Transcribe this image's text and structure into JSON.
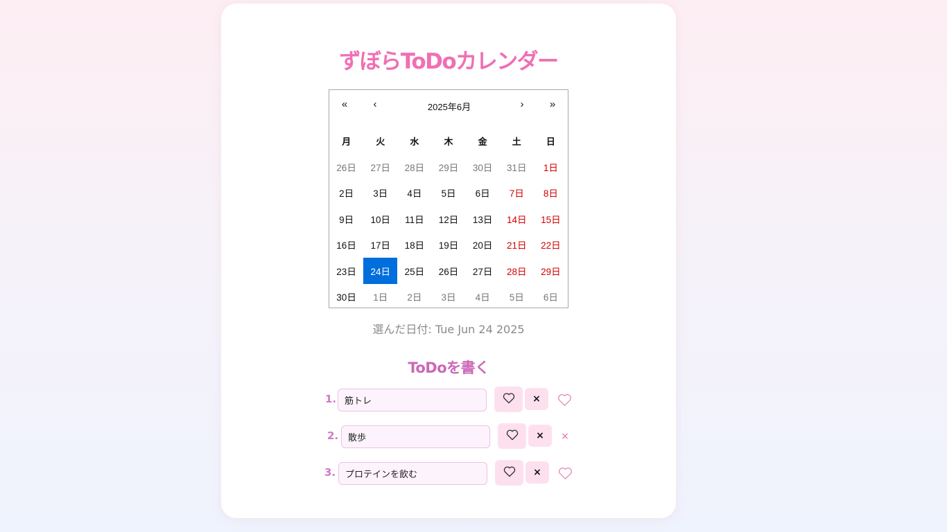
{
  "app": {
    "title": "ずぼらToDoカレンダー"
  },
  "calendar": {
    "nav": {
      "prev_year": "«",
      "prev_month": "‹",
      "label": "2025年6月",
      "next_month": "›",
      "next_year": "»"
    },
    "weekdays": [
      "月",
      "火",
      "水",
      "木",
      "金",
      "土",
      "日"
    ],
    "days": [
      {
        "label": "26日",
        "type": "neighbor"
      },
      {
        "label": "27日",
        "type": "neighbor"
      },
      {
        "label": "28日",
        "type": "neighbor"
      },
      {
        "label": "29日",
        "type": "neighbor"
      },
      {
        "label": "30日",
        "type": "neighbor"
      },
      {
        "label": "31日",
        "type": "neighbor"
      },
      {
        "label": "1日",
        "type": "weekend"
      },
      {
        "label": "2日",
        "type": "normal"
      },
      {
        "label": "3日",
        "type": "normal"
      },
      {
        "label": "4日",
        "type": "normal"
      },
      {
        "label": "5日",
        "type": "normal"
      },
      {
        "label": "6日",
        "type": "normal"
      },
      {
        "label": "7日",
        "type": "weekend"
      },
      {
        "label": "8日",
        "type": "weekend"
      },
      {
        "label": "9日",
        "type": "normal"
      },
      {
        "label": "10日",
        "type": "normal"
      },
      {
        "label": "11日",
        "type": "normal"
      },
      {
        "label": "12日",
        "type": "normal"
      },
      {
        "label": "13日",
        "type": "normal"
      },
      {
        "label": "14日",
        "type": "weekend"
      },
      {
        "label": "15日",
        "type": "weekend"
      },
      {
        "label": "16日",
        "type": "normal"
      },
      {
        "label": "17日",
        "type": "normal"
      },
      {
        "label": "18日",
        "type": "normal"
      },
      {
        "label": "19日",
        "type": "normal"
      },
      {
        "label": "20日",
        "type": "normal"
      },
      {
        "label": "21日",
        "type": "weekend"
      },
      {
        "label": "22日",
        "type": "weekend"
      },
      {
        "label": "23日",
        "type": "normal"
      },
      {
        "label": "24日",
        "type": "selected"
      },
      {
        "label": "25日",
        "type": "normal"
      },
      {
        "label": "26日",
        "type": "normal"
      },
      {
        "label": "27日",
        "type": "normal"
      },
      {
        "label": "28日",
        "type": "weekend"
      },
      {
        "label": "29日",
        "type": "weekend"
      },
      {
        "label": "30日",
        "type": "normal"
      },
      {
        "label": "1日",
        "type": "neighbor"
      },
      {
        "label": "2日",
        "type": "neighbor"
      },
      {
        "label": "3日",
        "type": "neighbor"
      },
      {
        "label": "4日",
        "type": "neighbor"
      },
      {
        "label": "5日",
        "type": "neighbor"
      },
      {
        "label": "6日",
        "type": "neighbor"
      }
    ]
  },
  "selected_date": {
    "text": "選んだ日付: Tue Jun 24 2025"
  },
  "todo": {
    "heading": "ToDoを書く",
    "items": [
      {
        "number": "1.",
        "value": "筋トレ",
        "heart_icon": "heart-outline-icon",
        "delete_label": "×",
        "status_icon": "heart-outline-icon"
      },
      {
        "number": "2.",
        "value": "散歩",
        "heart_icon": "heart-outline-icon",
        "delete_label": "×",
        "status_icon": "x-mark-icon",
        "status_text": "×"
      },
      {
        "number": "3.",
        "value": "プロテインを飲む",
        "heart_icon": "heart-outline-icon",
        "delete_label": "×",
        "status_icon": "heart-outline-icon"
      }
    ]
  },
  "colors": {
    "title": "#f06fb4",
    "heading": "#cb68b6",
    "selected_day": "#006edc",
    "weekend": "#d10000",
    "button_bg": "#fde0ee",
    "input_bg": "#fdf3fc",
    "input_border": "#ecc1e6"
  }
}
